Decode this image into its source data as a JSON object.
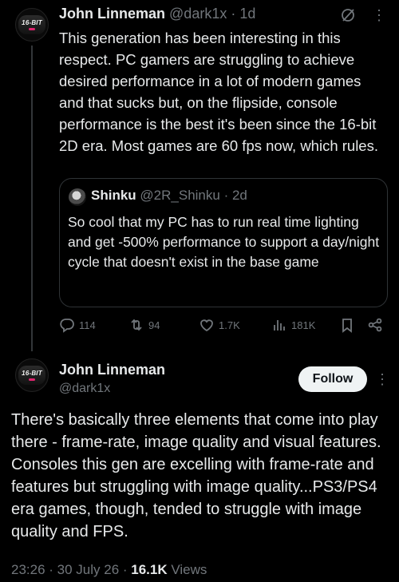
{
  "tweet1": {
    "avatar_text": "16-BIT",
    "name": "John Linneman",
    "handle": "@dark1x",
    "separator": " · ",
    "time": "1d",
    "body": "This generation has been interesting in this respect. PC gamers are struggling to achieve desired performance in a lot of modern games and that sucks but, on the flipside, console performance is the best it's been since the 16-bit 2D era. Most games are 60 fps now, which rules.",
    "quote": {
      "name": "Shinku",
      "handle": "@2R_Shinku",
      "separator": " · ",
      "time": "2d",
      "body": "So cool that my PC has to run real time lighting and get -500% performance to support a day/night cycle that doesn't exist in the base game"
    },
    "actions": {
      "replies": "114",
      "reposts": "94",
      "likes": "1.7K",
      "views": "181K"
    }
  },
  "tweet2": {
    "avatar_text": "16-BIT",
    "name": "John Linneman",
    "handle": "@dark1x",
    "follow_label": "Follow",
    "body": "There's basically three elements that come into play there - frame-rate, image quality and visual features. Consoles this gen are excelling with frame-rate and features but struggling with image quality...PS3/PS4 era games, though, tended to struggle with image quality and FPS.",
    "time": "23:26",
    "date": "30 July 26",
    "views_count": "16.1K",
    "views_label": "Views"
  },
  "icons": [
    "grok-icon",
    "more-icon",
    "reply-icon",
    "repost-icon",
    "like-icon",
    "views-icon",
    "bookmark-icon",
    "share-icon"
  ]
}
